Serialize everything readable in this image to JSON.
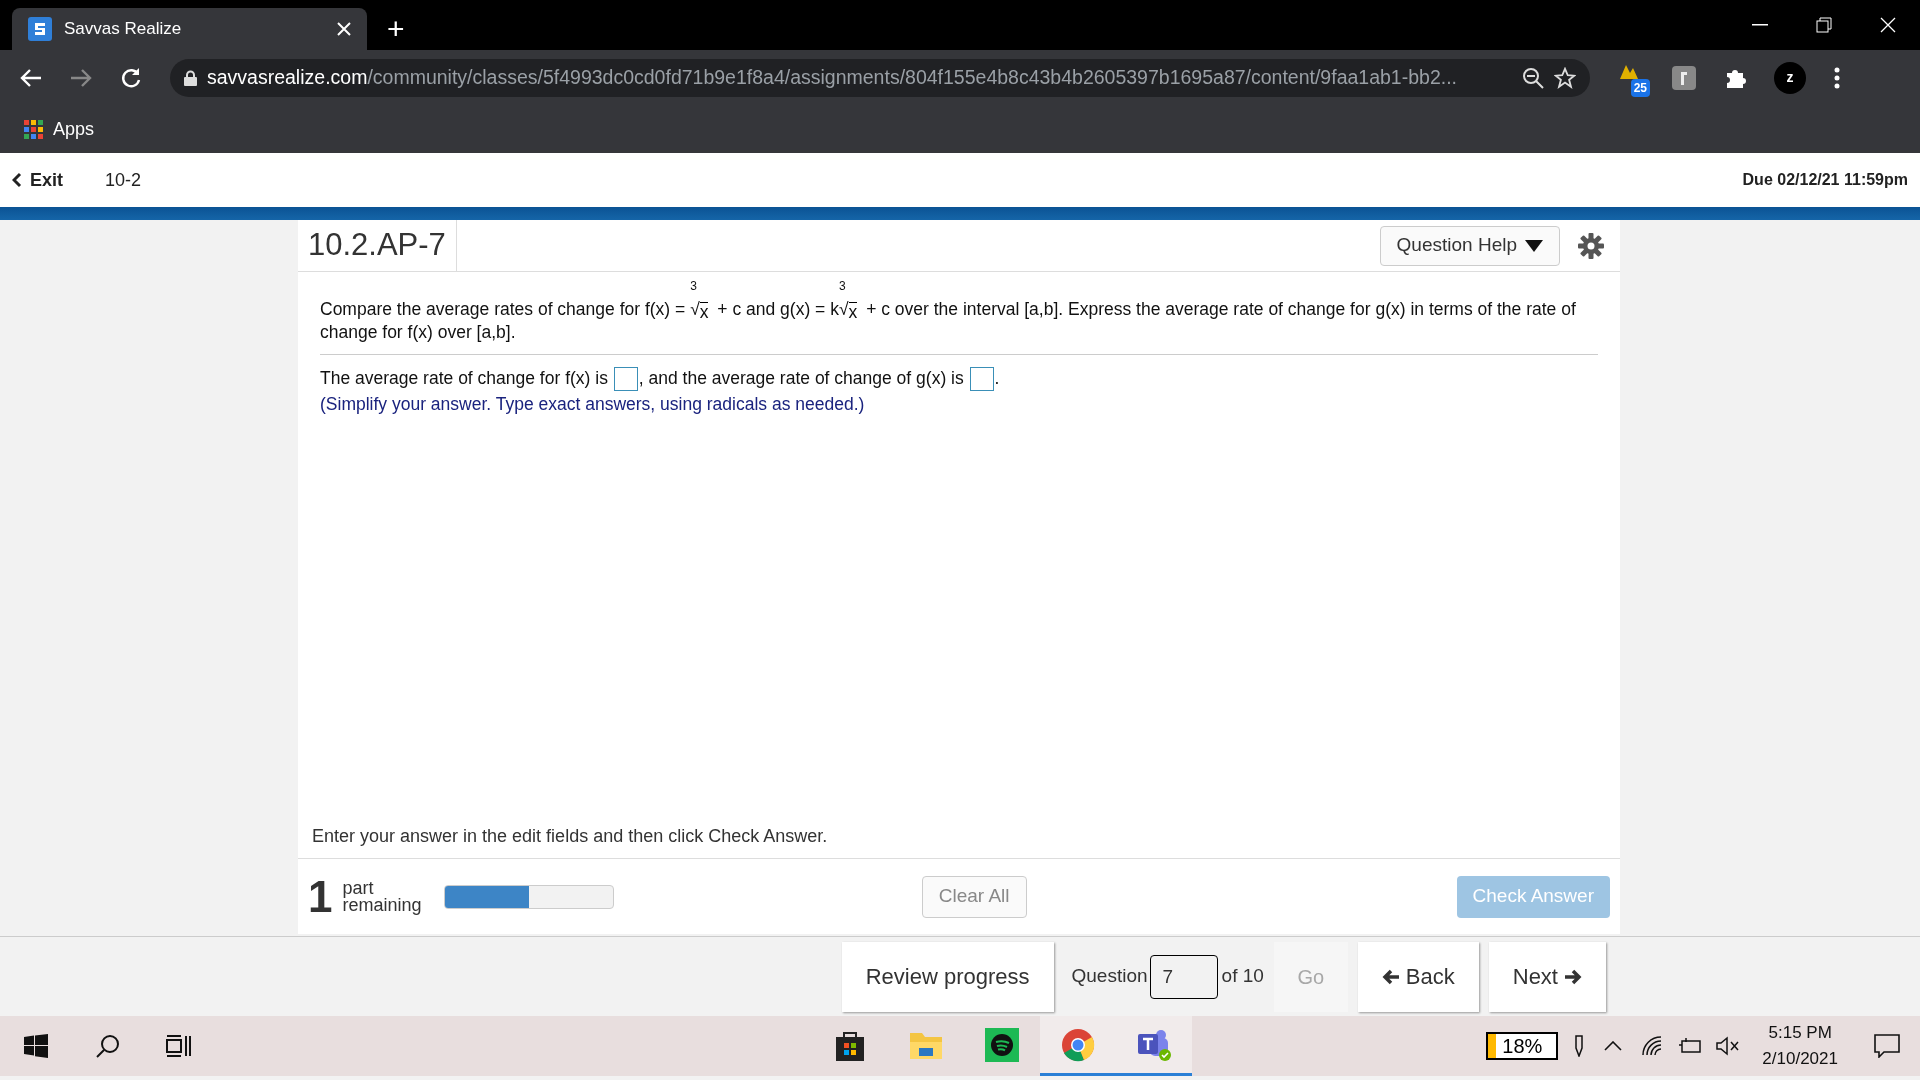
{
  "browser": {
    "tabs": [
      {
        "title": "Savvas Realize",
        "selected": true
      }
    ],
    "new_tab": "+",
    "url_host": "savvasrealize.com",
    "url_path": "/community/classes/5f4993dc0cd0fd71b9e1f8a4/assignments/804f155e4b8c43b4b2605397b1695a87/content/9faa1ab1-bb2...",
    "extension_badge": "25",
    "profile": "z",
    "bookmarks": [
      "Apps"
    ]
  },
  "header": {
    "exit": "Exit",
    "assignment": "10-2",
    "due": "Due 02/12/21 11:59pm"
  },
  "question": {
    "id": "10.2.AP-7",
    "help": "Question Help",
    "prompt": [
      {
        "kind": "text",
        "text": "Compare the average rates of change for f(x) = "
      },
      {
        "kind": "root",
        "index": "3",
        "sign": "√",
        "radicand": "x"
      },
      {
        "kind": "text",
        "text": " + c and g(x) = k"
      },
      {
        "kind": "root",
        "index": "3",
        "sign": "√",
        "radicand": "x"
      },
      {
        "kind": "text",
        "text": " + c over the interval [a,b]. Express the average rate of change for g(x) in terms of the rate of change for f(x) over [a,b]."
      }
    ],
    "answer_line": [
      {
        "kind": "text",
        "text": "The average rate of change for f(x) is "
      },
      {
        "kind": "input"
      },
      {
        "kind": "text",
        "text": ", and the average rate of change of g(x) is "
      },
      {
        "kind": "input"
      },
      {
        "kind": "text",
        "text": "."
      }
    ],
    "hint": "(Simplify your answer. Type exact answers, using radicals as needed.)",
    "instruction": "Enter your answer in the edit fields and then click Check Answer.",
    "parts_count": "1",
    "parts_label": "part remaining",
    "progress": {
      "level": 0.5
    },
    "clear_all": "Clear All",
    "check_answer": "Check Answer"
  },
  "navigation": {
    "review": "Review progress",
    "question_label": "Question",
    "question_value": "7",
    "of": "of 10",
    "go": "Go",
    "back": "Back",
    "next": "Next"
  },
  "taskbar": {
    "apps": [
      {
        "kind": "store",
        "selected": false
      },
      {
        "kind": "folder",
        "selected": false
      },
      {
        "kind": "spotify",
        "selected": false
      },
      {
        "kind": "chrome",
        "selected": true
      },
      {
        "kind": "teams",
        "selected": true
      }
    ],
    "battery": "18%",
    "time": "5:15 PM",
    "date": "2/10/2021"
  }
}
